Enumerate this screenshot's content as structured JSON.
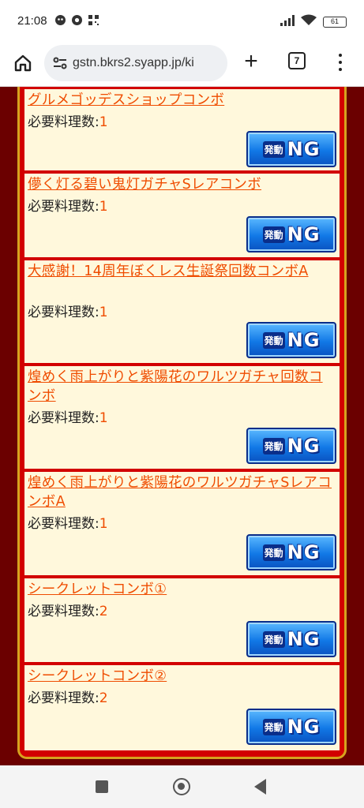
{
  "status_bar": {
    "time": "21:08",
    "battery": "61",
    "icons": [
      "notification-icon",
      "chrome-icon",
      "qr-icon",
      "signal-icon",
      "wifi-icon",
      "battery-icon"
    ]
  },
  "browser": {
    "url": "gstn.bkrs2.syapp.jp/ki",
    "tab_count": "7",
    "plus_label": "+"
  },
  "cards": [
    {
      "title": "グルメゴッデスショップコンボ",
      "req_label": "必要料理数:",
      "req_value": "1",
      "button_kanji": "発動",
      "button_text": "NG"
    },
    {
      "title": "儚く灯る碧い鬼灯ガチャSレアコンボ",
      "req_label": "必要料理数:",
      "req_value": "1",
      "button_kanji": "発動",
      "button_text": "NG"
    },
    {
      "title": "大感謝！14周年ぼくレス生誕祭回数コンボA",
      "req_label": "必要料理数:",
      "req_value": "1",
      "button_kanji": "発動",
      "button_text": "NG"
    },
    {
      "title": "煌めく雨上がりと紫陽花のワルツガチャ回数コンボ",
      "req_label": "必要料理数:",
      "req_value": "1",
      "button_kanji": "発動",
      "button_text": "NG"
    },
    {
      "title": "煌めく雨上がりと紫陽花のワルツガチャSレアコンボA",
      "req_label": "必要料理数:",
      "req_value": "1",
      "button_kanji": "発動",
      "button_text": "NG"
    },
    {
      "title": "シークレットコンボ①",
      "req_label": "必要料理数:",
      "req_value": "2",
      "button_kanji": "発動",
      "button_text": "NG"
    },
    {
      "title": "シークレットコンボ②",
      "req_label": "必要料理数:",
      "req_value": "2",
      "button_kanji": "発動",
      "button_text": "NG"
    }
  ],
  "colors": {
    "page_background": "#6b0000",
    "frame_border": "#d7a21e",
    "card_background": "#fff8dc",
    "link_orange": "#ef4c00",
    "button_blue": "#1178e6"
  }
}
